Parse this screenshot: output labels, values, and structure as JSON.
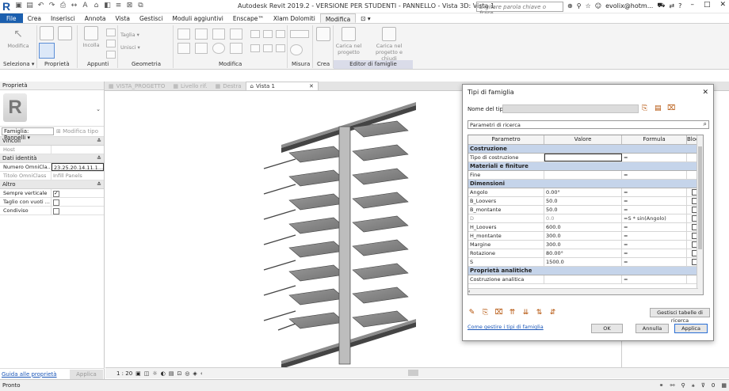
{
  "titlebar": {
    "app_title": "Autodesk Revit 2019.2 - VERSIONE PER STUDENTI - PANNELLO - Vista 3D: Vista 1",
    "search_placeholder": "Digitare parola chiave o frase",
    "user": "evolix@hotm...",
    "help": "?"
  },
  "menu": {
    "tabs": [
      "File",
      "Crea",
      "Inserisci",
      "Annota",
      "Vista",
      "Gestisci",
      "Moduli aggiuntivi",
      "Enscape™",
      "Xlam Dolomiti",
      "Modifica"
    ],
    "active": "Modifica"
  },
  "ribbon": {
    "modifica_label": "Modifica",
    "incolla_label": "Incolla",
    "taglia_label": "Taglia",
    "unisci_label": "Unisci",
    "carica_progetto": "Carica nel progetto",
    "carica_chiudi": "Carica nel progetto e chiudi",
    "panels": {
      "seleziona": "Seleziona ▾",
      "proprieta": "Proprietà",
      "appunti": "Appunti",
      "geometria": "Geometria",
      "modifica": "Modifica",
      "misura": "Misura",
      "crea": "Crea",
      "editor": "Editor di famiglie"
    }
  },
  "properties": {
    "header": "Proprietà",
    "family_select": "Famiglia: Pannelli",
    "edit_type": "Modifica tipo",
    "categories": [
      {
        "name": "Vincoli",
        "rows": [
          {
            "k": "Host",
            "v": "",
            "dim": true
          }
        ]
      },
      {
        "name": "Dati identità",
        "rows": [
          {
            "k": "Numero OmniCla...",
            "v": "23.25.20.14.11.1..."
          },
          {
            "k": "Titolo OmniClass",
            "v": "Infill Panels",
            "dim": true
          }
        ]
      },
      {
        "name": "Altro",
        "rows": [
          {
            "k": "Sempre verticale",
            "check": true
          },
          {
            "k": "Taglio con vuoti ...",
            "check": false
          },
          {
            "k": "Condiviso",
            "check": false
          }
        ]
      }
    ],
    "help_link": "Guida alle proprietà",
    "apply": "Applica"
  },
  "view_tabs": [
    "VISTA_PROGETTO",
    "Livello rif.",
    "Destra",
    "Vista 1"
  ],
  "active_view": "Vista 1",
  "canvas": {
    "scale": "1 : 20"
  },
  "status": {
    "text": "Pronto",
    "filter": "0"
  },
  "dialog": {
    "title": "Tipi di famiglia",
    "type_name_label": "Nome del tipo:",
    "search_placeholder": "Parametri di ricerca",
    "columns": [
      "Parametro",
      "Valore",
      "Formula",
      "Blocca"
    ],
    "groups": [
      {
        "name": "Costruzione",
        "rows": [
          {
            "p": "Tipo di costruzione",
            "v": "",
            "f": "=",
            "edit": true
          }
        ]
      },
      {
        "name": "Materiali e finiture",
        "rows": [
          {
            "p": "Fine",
            "v": "",
            "f": "="
          }
        ]
      },
      {
        "name": "Dimensioni",
        "rows": [
          {
            "p": "Angolo",
            "v": "0.00°",
            "f": "=",
            "chk": true
          },
          {
            "p": "B_Loovers",
            "v": "50.0",
            "f": "=",
            "chk": true
          },
          {
            "p": "B_montante",
            "v": "50.0",
            "f": "=",
            "chk": true
          },
          {
            "p": "D",
            "v": "0.0",
            "f": "=S * sin(Angolo)",
            "chk": true,
            "dim": true
          },
          {
            "p": "H_Loovers",
            "v": "600.0",
            "f": "=",
            "chk": true
          },
          {
            "p": "H_montante",
            "v": "300.0",
            "f": "=",
            "chk": true
          },
          {
            "p": "Margine",
            "v": "300.0",
            "f": "=",
            "chk": true
          },
          {
            "p": "Rotazione",
            "v": "80.00°",
            "f": "=",
            "chk": true
          },
          {
            "p": "S",
            "v": "1500.0",
            "f": "=",
            "chk": true
          }
        ]
      },
      {
        "name": "Proprietà analitiche",
        "rows": [
          {
            "p": "Costruzione analitica",
            "v": "",
            "f": "="
          }
        ]
      }
    ],
    "manage_lookup": "Gestisci tabelle di ricerca",
    "help_link": "Come gestire i tipi di famiglia",
    "ok": "OK",
    "cancel": "Annulla",
    "apply": "Applica"
  }
}
